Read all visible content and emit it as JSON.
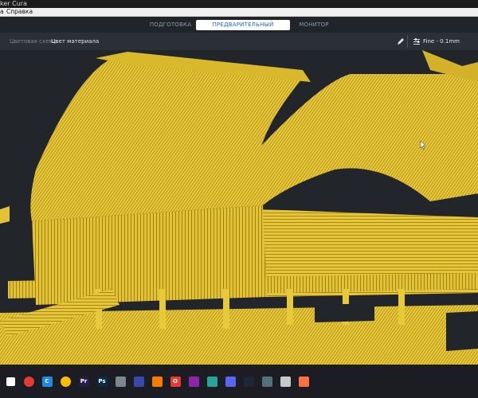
{
  "window": {
    "title": "ker Cura"
  },
  "menu": {
    "items": [
      "а",
      "Справка"
    ]
  },
  "stages": [
    {
      "label": "ПОДГОТОВКА",
      "active": false
    },
    {
      "label": "ПРЕДВАРИТЕЛЬНЫЙ ПРОСМОТР",
      "active": true
    },
    {
      "label": "МОНИТОР",
      "active": false
    }
  ],
  "toolbar": {
    "color_scheme_label": "Цветовая схема",
    "color_scheme_value": "Цвет материала",
    "edit_icon": "pencil-icon",
    "profile_icon": "sliders-icon",
    "profile": "Fine - 0.1mm"
  },
  "viewport": {
    "model_color": "#e8c93a",
    "model_shadow": "#a6881c",
    "background": "#22262b",
    "cursor_icon": "arrow-cursor-icon"
  },
  "layer_slider": {
    "progress": 1.0
  },
  "taskbar": {
    "icons": [
      {
        "name": "start-icon",
        "color": "#ffffff",
        "glyph": ""
      },
      {
        "name": "record-icon",
        "color": "#e53935",
        "glyph": ""
      },
      {
        "name": "cura-icon",
        "color": "#1e88e5",
        "glyph": "C"
      },
      {
        "name": "chrome-icon",
        "color": "#fbbc05",
        "glyph": ""
      },
      {
        "name": "premiere-icon",
        "color": "#2a1a4a",
        "glyph": "Pr"
      },
      {
        "name": "photoshop-icon",
        "color": "#0b2b4a",
        "glyph": "Ps"
      },
      {
        "name": "app-icon-1",
        "color": "#7c8590",
        "glyph": ""
      },
      {
        "name": "app-icon-2",
        "color": "#3949ab",
        "glyph": ""
      },
      {
        "name": "app-icon-3",
        "color": "#f57c00",
        "glyph": ""
      },
      {
        "name": "opera-icon",
        "color": "#e53935",
        "glyph": "O"
      },
      {
        "name": "app-icon-4",
        "color": "#8e24aa",
        "glyph": ""
      },
      {
        "name": "app-icon-5",
        "color": "#26a69a",
        "glyph": ""
      },
      {
        "name": "discord-icon",
        "color": "#5865f2",
        "glyph": ""
      },
      {
        "name": "steam-icon",
        "color": "#1b2838",
        "glyph": ""
      },
      {
        "name": "app-icon-6",
        "color": "#546e7a",
        "glyph": ""
      },
      {
        "name": "app-icon-7",
        "color": "#c8c8c8",
        "glyph": ""
      },
      {
        "name": "app-icon-8",
        "color": "#ff7043",
        "glyph": ""
      }
    ]
  }
}
